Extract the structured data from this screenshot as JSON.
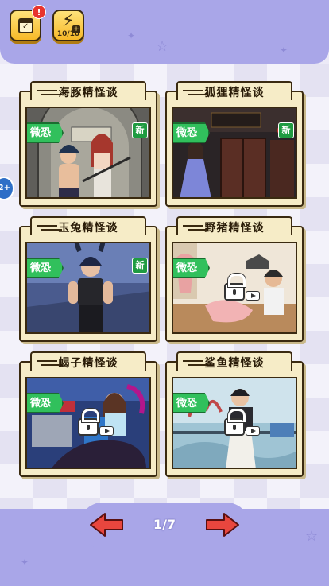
{
  "header": {
    "calendar_badge": "!",
    "energy": "10/10"
  },
  "side_tab": {
    "label": "2+"
  },
  "stories": [
    {
      "title": "海豚精怪谈",
      "tag": "微恐",
      "is_new": true,
      "new_label": "新",
      "locked": false
    },
    {
      "title": "狐狸精怪谈",
      "tag": "微恐",
      "is_new": true,
      "new_label": "新",
      "locked": false
    },
    {
      "title": "玉兔精怪谈",
      "tag": "微恐",
      "is_new": true,
      "new_label": "新",
      "locked": false
    },
    {
      "title": "野猪精怪谈",
      "tag": "微恐",
      "is_new": false,
      "locked": true
    },
    {
      "title": "蝎子精怪谈",
      "tag": "微恐",
      "is_new": false,
      "locked": true
    },
    {
      "title": "鲨鱼精怪谈",
      "tag": "微恐",
      "is_new": false,
      "locked": true
    }
  ],
  "pagination": {
    "current": "1/7"
  },
  "colors": {
    "top_bar": "#a9a6e8",
    "card_bg": "#f6ecc7",
    "tag_green": "#31c05c",
    "arrow_red": "#e8463e"
  }
}
